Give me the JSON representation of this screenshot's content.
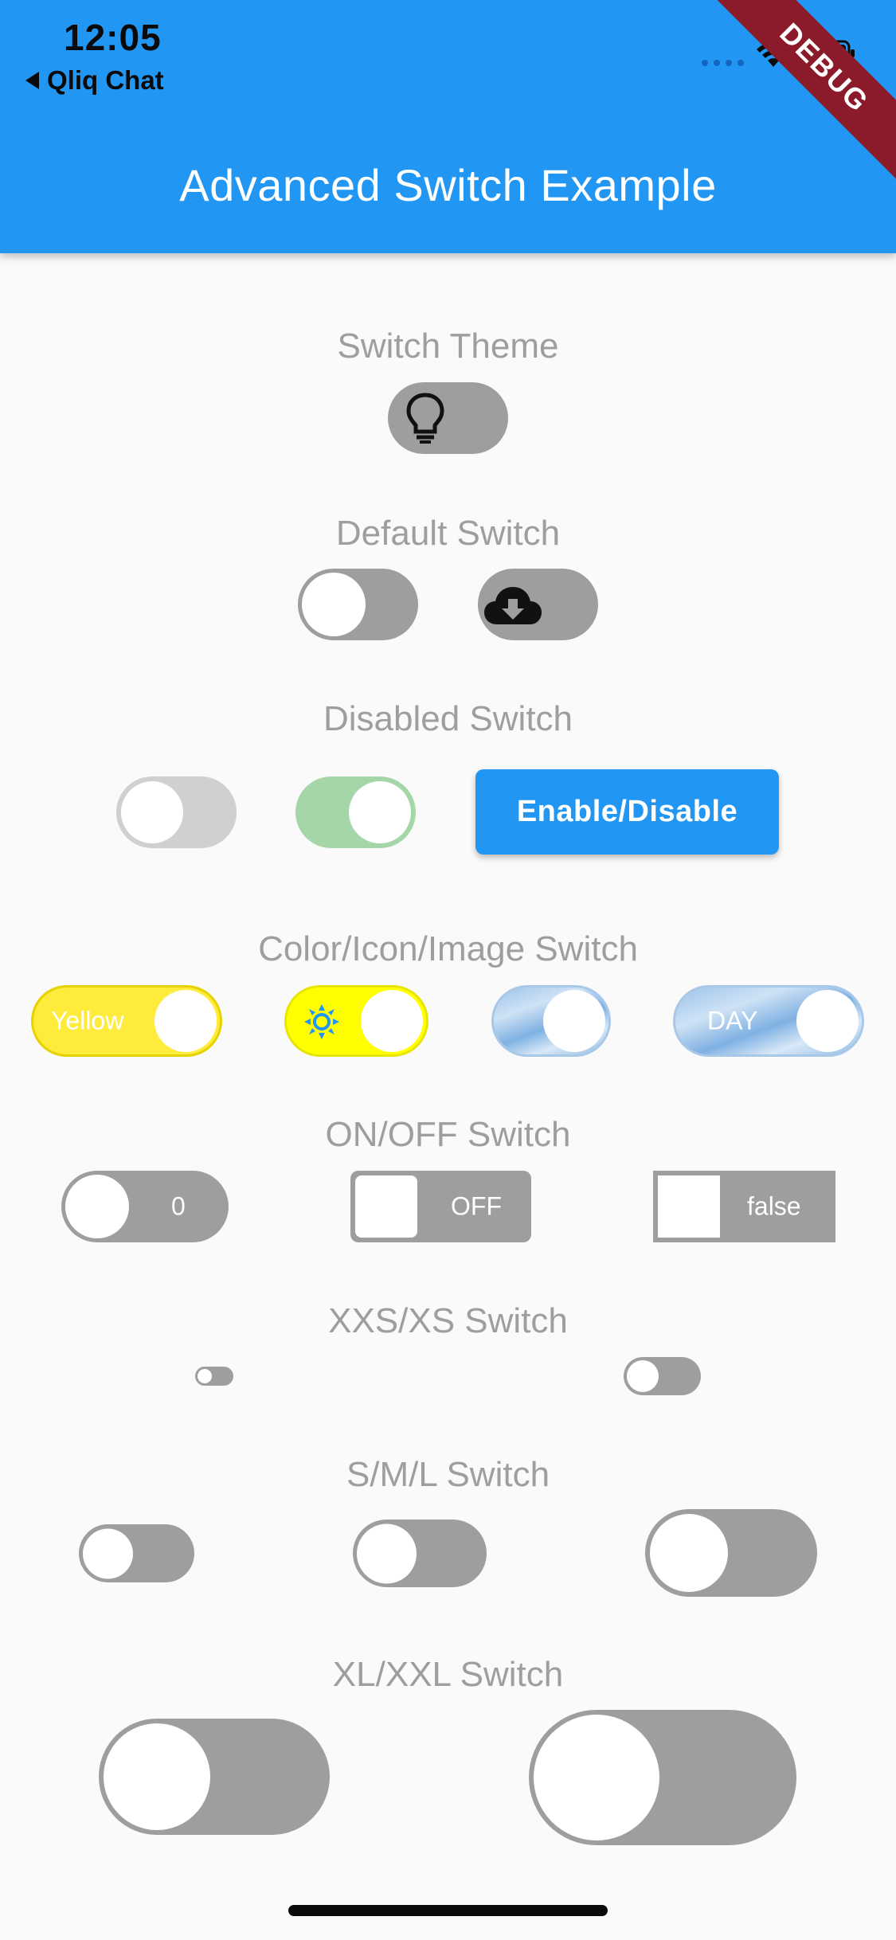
{
  "status_bar": {
    "time": "12:05",
    "back_label": "Qliq Chat"
  },
  "app_bar": {
    "title": "Advanced Switch Example",
    "debug_banner": "DEBUG"
  },
  "sections": {
    "theme": {
      "label": "Switch Theme",
      "switch_icon": "lightbulb-icon",
      "value": false
    },
    "default": {
      "label": "Default Switch",
      "switches": [
        {
          "value": false
        },
        {
          "value": false,
          "icon": "cloud-download-icon"
        }
      ]
    },
    "disabled": {
      "label": "Disabled Switch",
      "switches": [
        {
          "value": false,
          "enabled": false
        },
        {
          "value": true,
          "enabled": false
        }
      ],
      "button_label": "Enable/Disable"
    },
    "color_icon_image": {
      "label": "Color/Icon/Image Switch",
      "yellow_text": "Yellow",
      "sun_icon": "sun-icon",
      "day_text": "DAY"
    },
    "on_off": {
      "label": "ON/OFF Switch",
      "texts": [
        "0",
        "OFF",
        "false"
      ]
    },
    "xxs_xs": {
      "label": "XXS/XS Switch"
    },
    "s_m_l": {
      "label": "S/M/L Switch"
    },
    "xl_xxl": {
      "label": "XL/XXL Switch"
    }
  },
  "colors": {
    "primary": "#2196f3",
    "switch_off": "#9e9e9e",
    "disabled_track": "#d0d0d0",
    "disabled_active": "#a5d6a7",
    "yellow": "#ffeb3b",
    "label": "#9e9e9e"
  }
}
